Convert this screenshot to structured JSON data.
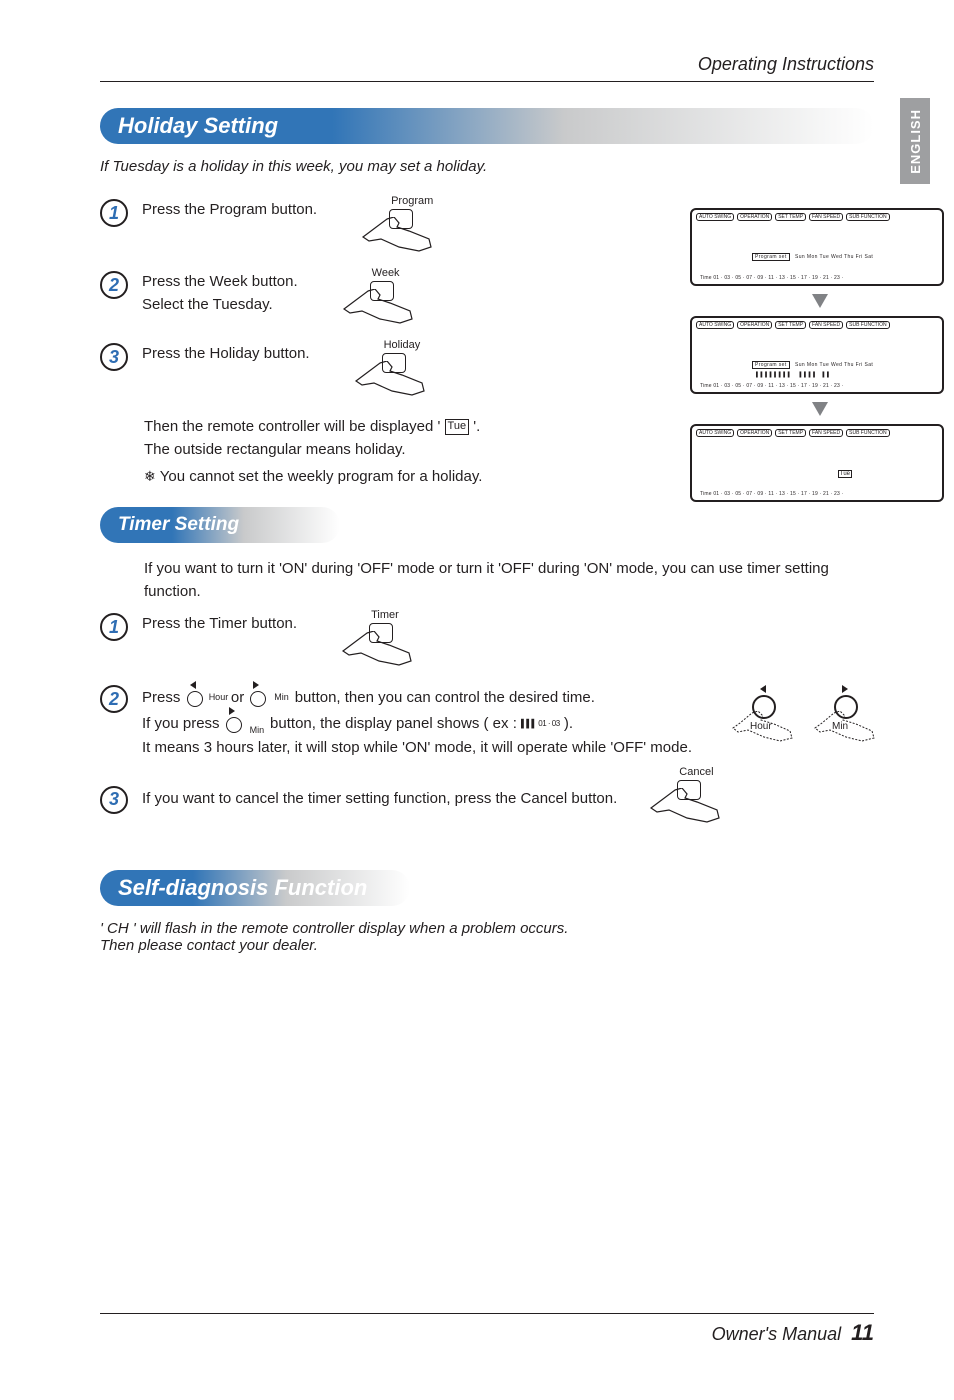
{
  "header": {
    "operating_instructions": "Operating Instructions",
    "side_tab": "ENGLISH"
  },
  "sections": {
    "holiday": {
      "title": "Holiday Setting",
      "intro": "If Tuesday is a holiday in this week, you may set a holiday.",
      "steps": [
        {
          "num": "1",
          "text": "Press the Program button.",
          "btn_label": "Program"
        },
        {
          "num": "2",
          "text": "Press the Week button.\nSelect the Tuesday.",
          "btn_label": "Week"
        },
        {
          "num": "3",
          "text": "Press the Holiday button.",
          "btn_label": "Holiday"
        }
      ],
      "post": {
        "line1a": "Then the remote controller will be displayed ' ",
        "tue": "Tue",
        "line1b": " '.",
        "line2": "The outside rectangular means holiday.",
        "note": "You cannot set the weekly program for a holiday."
      },
      "display": {
        "top_labels": [
          "AUTO SWING",
          "OPERATION",
          "SET TEMP",
          "FAN SPEED",
          "SUB FUNCTION"
        ],
        "program_set": "Program set",
        "days": "Sun   Mon   Tue   Wed   Thu   Fri   Sat",
        "time_scale": "Time  01 · 03 · 05 · 07 · 09 · 11 · 13 · 15 · 17 · 19 · 21 · 23 ·",
        "tue_box": "Tue"
      }
    },
    "timer": {
      "title": "Timer Setting",
      "intro": "If you want to turn it 'ON' during 'OFF' mode or turn it 'OFF' during 'ON' mode, you can use timer setting function.",
      "steps": {
        "s1": {
          "num": "1",
          "text": "Press the Timer button.",
          "btn_label": "Timer"
        },
        "s2": {
          "num": "2",
          "pre": "Press ",
          "or": " or ",
          "post1": " button, then you can control the desired time.",
          "line2a": "If you press ",
          "line2b": " button, the display panel shows ( ex : ",
          "bars": "▌▌▌  01 · 03",
          "line2c": " ).",
          "line3": "It means 3 hours later, it will stop while 'ON' mode, it will operate while 'OFF' mode.",
          "hour": "Hour",
          "min": "Min"
        },
        "s3": {
          "num": "3",
          "text": "If you want to cancel the timer setting function, press the Cancel button.",
          "btn_label": "Cancel"
        }
      }
    },
    "self": {
      "title": "Self-diagnosis Function",
      "line1": "' CH ' will flash in the remote controller display when a problem occurs.",
      "line2": "Then please contact your dealer."
    }
  },
  "footer": {
    "manual": "Owner's Manual",
    "page": "11"
  }
}
